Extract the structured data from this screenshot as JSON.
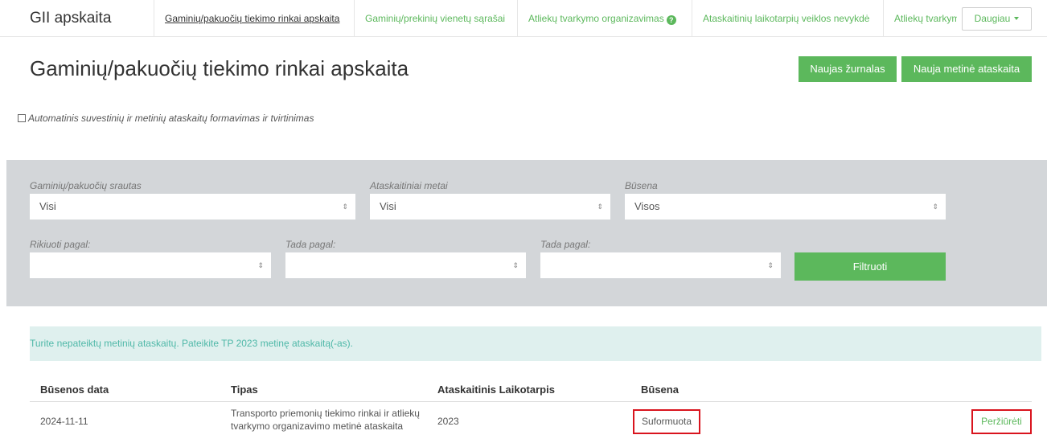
{
  "brand": "GII apskaita",
  "nav": {
    "links": [
      "Gaminių/pakuočių tiekimo rinkai apskaita",
      "Gaminių/prekinių vienetų sąrašai",
      "Atliekų tvarkymo organizavimas",
      "Ataskaitinių laikotarpių veiklos nevykdė",
      "Atliekų tvarkym"
    ],
    "more": "Daugiau"
  },
  "header": {
    "title": "Gaminių/pakuočių tiekimo rinkai apskaita",
    "new_journal": "Naujas žurnalas",
    "new_annual": "Nauja metinė ataskaita"
  },
  "auto_option": "Automatinis suvestinių ir metinių ataskaitų formavimas ir tvirtinimas",
  "filters": {
    "flow_label": "Gaminių/pakuočių srautas",
    "flow_value": "Visi",
    "year_label": "Ataskaitiniai metai",
    "year_value": "Visi",
    "status_label": "Būsena",
    "status_value": "Visos",
    "sort_label": "Rikiuoti pagal:",
    "then1_label": "Tada pagal:",
    "then2_label": "Tada pagal:",
    "filter_button": "Filtruoti"
  },
  "alert": "Turite nepateiktų metinių ataskaitų. Pateikite TP 2023 metinę ataskaitą(-as).",
  "table": {
    "headers": [
      "Būsenos data",
      "Tipas",
      "Ataskaitinis Laikotarpis",
      "Būsena"
    ],
    "rows": [
      {
        "date": "2024-11-11",
        "type_line1": "Transporto priemonių tiekimo rinkai ir atliekų",
        "type_line2": "tvarkymo organizavimo metinė ataskaita",
        "period": "2023",
        "status": "Suformuota",
        "action": "Peržiūrėti"
      }
    ]
  },
  "colors": {
    "accent_green": "#5cb85c",
    "filter_bg": "#d3d6d9",
    "alert_bg": "#dff0ee",
    "highlight_red": "#d9141e"
  }
}
